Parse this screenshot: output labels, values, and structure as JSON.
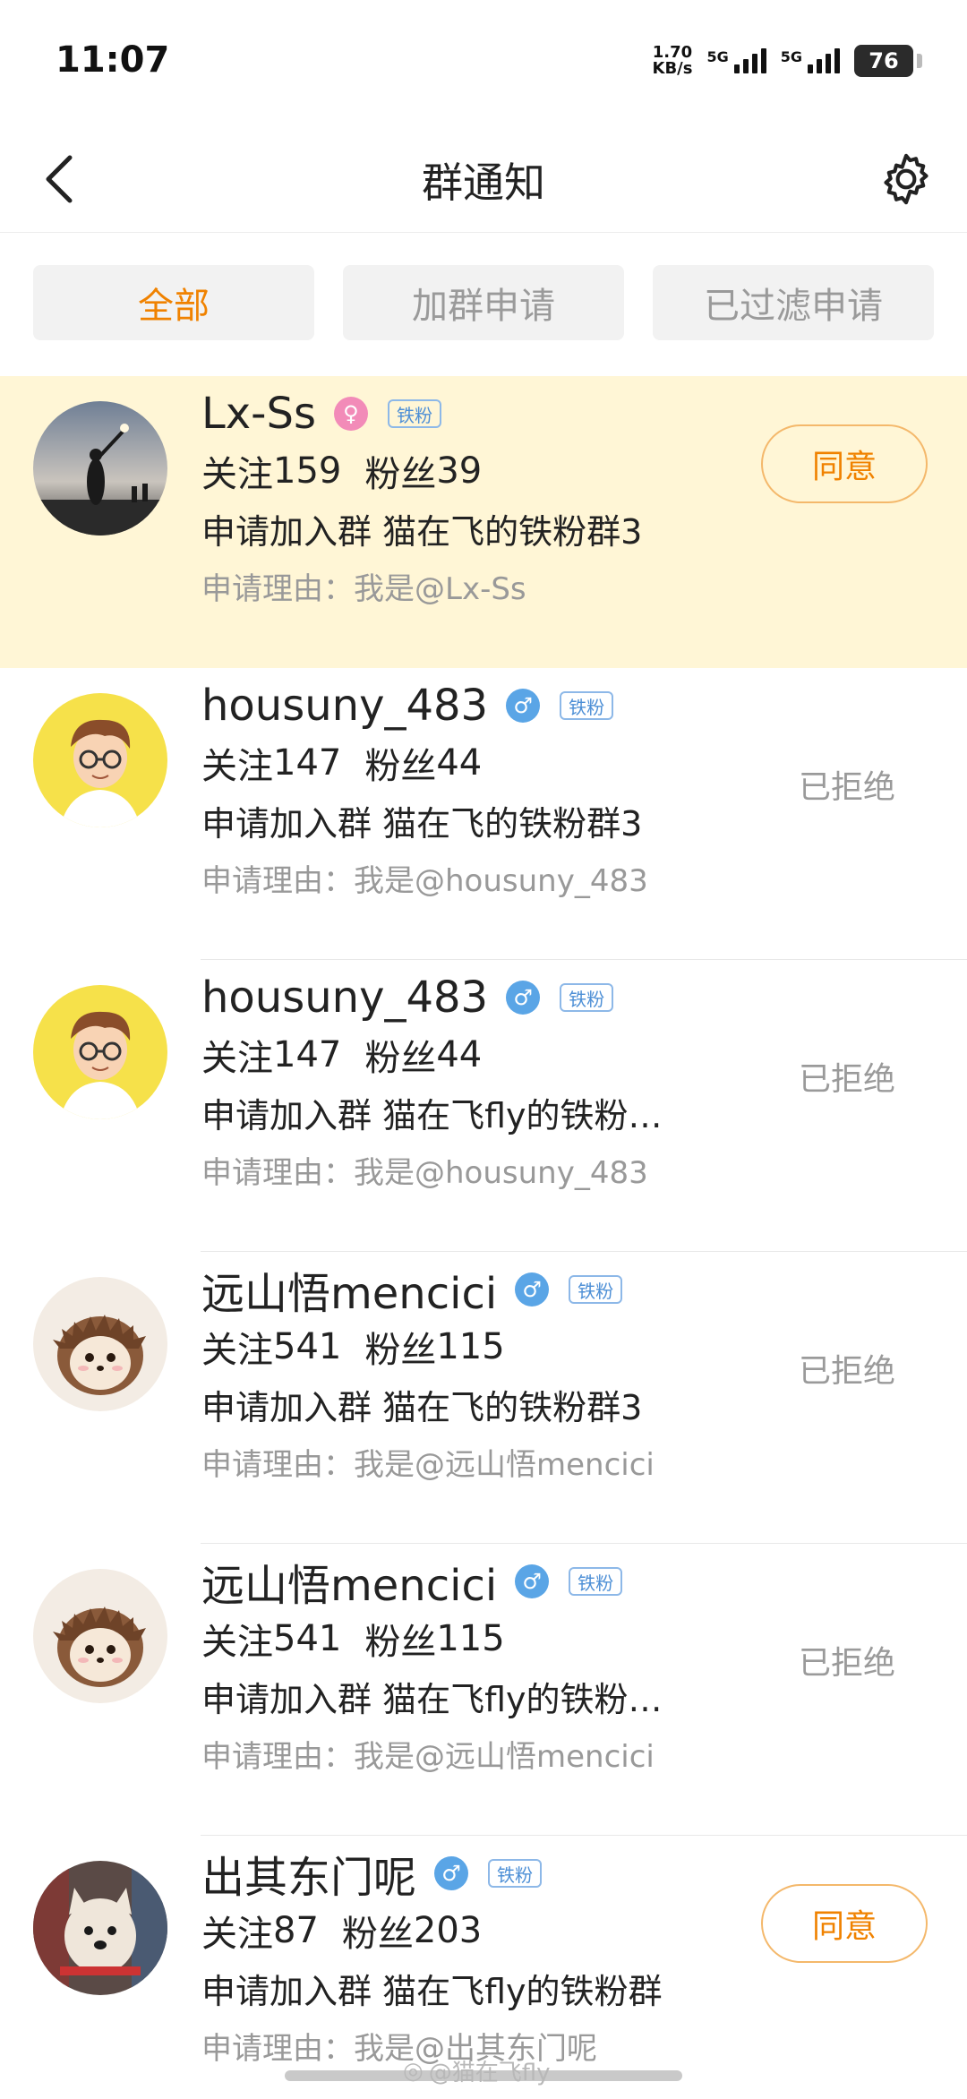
{
  "status_bar": {
    "time": "11:07",
    "net_speed_value": "1.70",
    "net_speed_unit": "KB/s",
    "sim1_label": "5G",
    "sim2_label": "5G",
    "battery": "76"
  },
  "header": {
    "title": "群通知"
  },
  "tabs": [
    {
      "label": "全部",
      "active": true
    },
    {
      "label": "加群申请",
      "active": false
    },
    {
      "label": "已过滤申请",
      "active": false
    }
  ],
  "notifications": [
    {
      "name": "Lx-Ss",
      "gender": "female",
      "badge": "铁粉",
      "follow_label": "关注",
      "follow": "159",
      "fans_label": "粉丝",
      "fans": "39",
      "apply_text": "申请加入群 猫在飞的铁粉群3",
      "reason": "申请理由：我是@Lx-Ss",
      "action": "同意",
      "status": "",
      "highlight": true
    },
    {
      "name": "housuny_483",
      "gender": "male",
      "badge": "铁粉",
      "follow_label": "关注",
      "follow": "147",
      "fans_label": "粉丝",
      "fans": "44",
      "apply_text": "申请加入群 猫在飞的铁粉群3",
      "reason": "申请理由：我是@housuny_483",
      "action": "",
      "status": "已拒绝",
      "highlight": false
    },
    {
      "name": "housuny_483",
      "gender": "male",
      "badge": "铁粉",
      "follow_label": "关注",
      "follow": "147",
      "fans_label": "粉丝",
      "fans": "44",
      "apply_text": "申请加入群 猫在飞fly的铁粉…",
      "reason": "申请理由：我是@housuny_483",
      "action": "",
      "status": "已拒绝",
      "highlight": false
    },
    {
      "name": "远山悟mencici",
      "gender": "male",
      "badge": "铁粉",
      "follow_label": "关注",
      "follow": "541",
      "fans_label": "粉丝",
      "fans": "115",
      "apply_text": "申请加入群 猫在飞的铁粉群3",
      "reason": "申请理由：我是@远山悟mencici",
      "action": "",
      "status": "已拒绝",
      "highlight": false
    },
    {
      "name": "远山悟mencici",
      "gender": "male",
      "badge": "铁粉",
      "follow_label": "关注",
      "follow": "541",
      "fans_label": "粉丝",
      "fans": "115",
      "apply_text": "申请加入群 猫在飞fly的铁粉…",
      "reason": "申请理由：我是@远山悟mencici",
      "action": "",
      "status": "已拒绝",
      "highlight": false
    },
    {
      "name": "出其东门呢",
      "gender": "male",
      "badge": "铁粉",
      "follow_label": "关注",
      "follow": "87",
      "fans_label": "粉丝",
      "fans": "203",
      "apply_text": "申请加入群 猫在飞fly的铁粉群",
      "reason": "申请理由：我是@出其东门呢",
      "action": "同意",
      "status": "",
      "highlight": false
    }
  ],
  "watermark": "@猫在飞fly",
  "colors": {
    "accent": "#f08200",
    "highlight_bg": "#fff6d6",
    "muted_text": "#999999"
  }
}
